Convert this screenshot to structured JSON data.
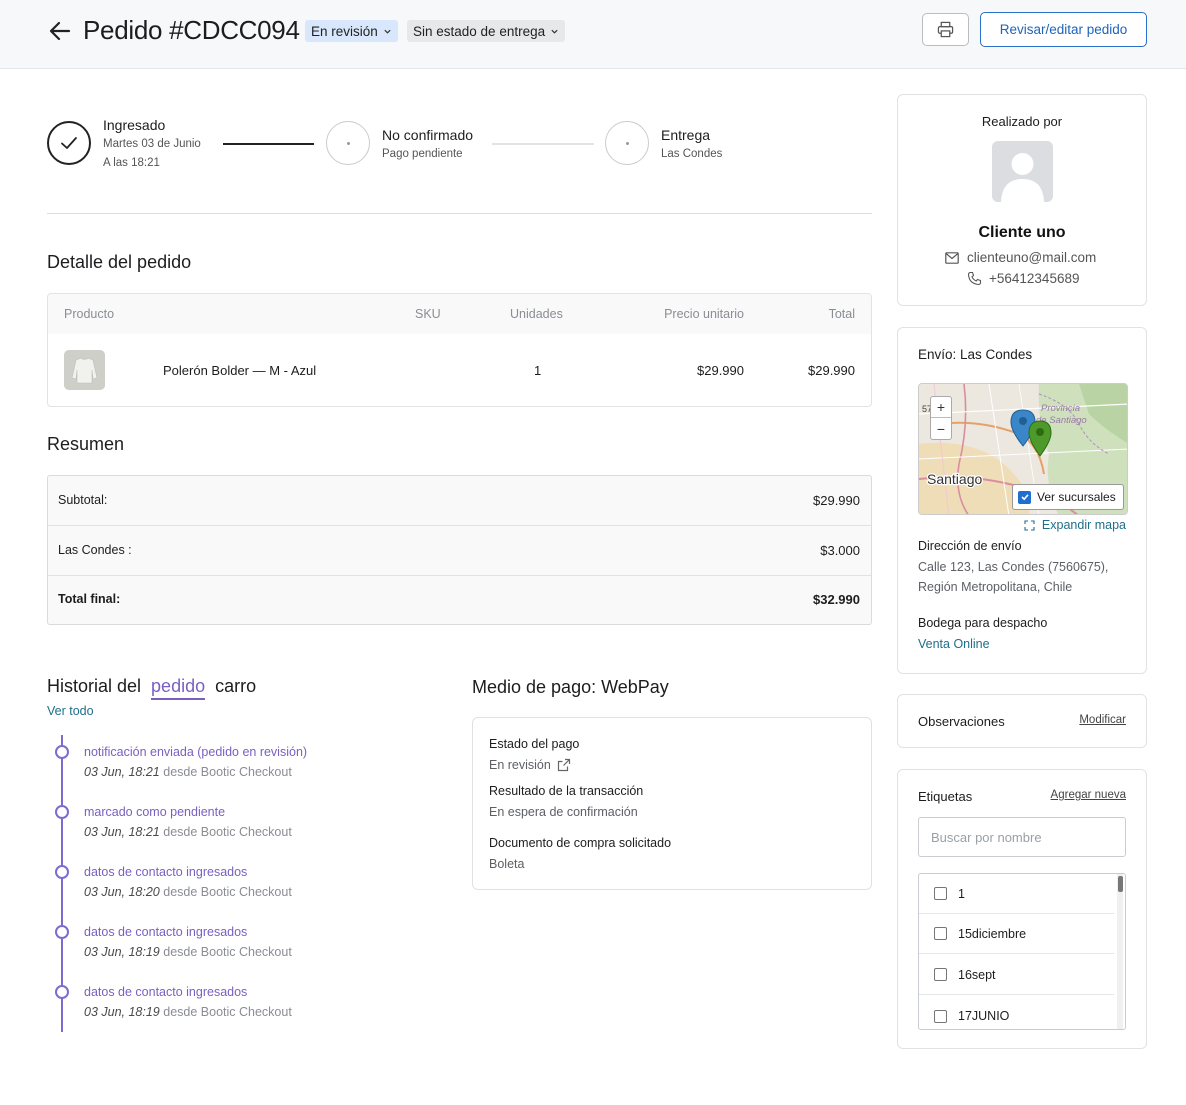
{
  "header": {
    "title": "Pedido #CDCC094",
    "status_pill": "En revisión",
    "delivery_pill": "Sin estado de entrega",
    "edit_button": "Revisar/editar pedido"
  },
  "progress": {
    "steps": [
      {
        "title": "Ingresado",
        "sub1": "Martes 03 de Junio",
        "sub2": "A las 18:21"
      },
      {
        "title": "No confirmado",
        "sub1": "Pago pendiente"
      },
      {
        "title": "Entrega",
        "sub1": "Las Condes"
      }
    ]
  },
  "order_detail": {
    "title": "Detalle del pedido",
    "columns": [
      "Producto",
      "SKU",
      "Unidades",
      "Precio unitario",
      "Total"
    ],
    "rows": [
      {
        "product": "Polerón Bolder — M - Azul",
        "sku": "",
        "units": "1",
        "unit_price": "$29.990",
        "total": "$29.990"
      }
    ]
  },
  "summary": {
    "title": "Resumen",
    "rows": [
      {
        "label": "Subtotal:",
        "value": "$29.990"
      },
      {
        "label": "Las Condes :",
        "value": "$3.000"
      },
      {
        "label": "Total final:",
        "value": "$32.990"
      }
    ]
  },
  "history": {
    "title": "Historial del",
    "tab_active": "pedido",
    "tab_other": "carro",
    "see_all": "Ver todo",
    "events": [
      {
        "title": "notificación enviada (pedido en revisión)",
        "when": "03 Jun, 18:21",
        "source": "desde Bootic Checkout"
      },
      {
        "title": "marcado como pendiente",
        "when": "03 Jun, 18:21",
        "source": "desde Bootic Checkout"
      },
      {
        "title": "datos de contacto ingresados",
        "when": "03 Jun, 18:20",
        "source": "desde Bootic Checkout"
      },
      {
        "title": "datos de contacto ingresados",
        "when": "03 Jun, 18:19",
        "source": "desde Bootic Checkout"
      },
      {
        "title": "datos de contacto ingresados",
        "when": "03 Jun, 18:19",
        "source": "desde Bootic Checkout"
      }
    ]
  },
  "payment": {
    "title": "Medio de pago: WebPay",
    "status_label": "Estado del pago",
    "status_value": "En revisión",
    "result_label": "Resultado de la transacción",
    "result_value": "En espera de confirmación",
    "doc_label": "Documento de compra solicitado",
    "doc_value": "Boleta"
  },
  "customer": {
    "label": "Realizado por",
    "name": "Cliente uno",
    "email": "clienteuno@mail.com",
    "phone": "+56412345689"
  },
  "shipping": {
    "title": "Envío: Las Condes",
    "map_city": "Santiago",
    "map_region_1": "Provincia",
    "map_region_2": "de Santiago",
    "map_edge_label": "57",
    "branches_toggle": "Ver sucursales",
    "expand_map": "Expandir mapa",
    "address_label": "Dirección de envío",
    "address_line1": "Calle 123, Las Condes (7560675),",
    "address_line2": "Región Metropolitana, Chile",
    "warehouse_label": "Bodega para despacho",
    "warehouse_value": "Venta Online"
  },
  "notes": {
    "title": "Observaciones",
    "action": "Modificar"
  },
  "tags": {
    "title": "Etiquetas",
    "action": "Agregar nueva",
    "search_placeholder": "Buscar por nombre",
    "items": [
      "1",
      "15diciembre",
      "16sept",
      "17JUNIO"
    ]
  },
  "colors": {
    "accent_purple": "#7a5fc2",
    "link_teal": "#1f6e8a",
    "button_blue": "#1f63bd",
    "pill_review_bg": "#d8e7fb"
  }
}
